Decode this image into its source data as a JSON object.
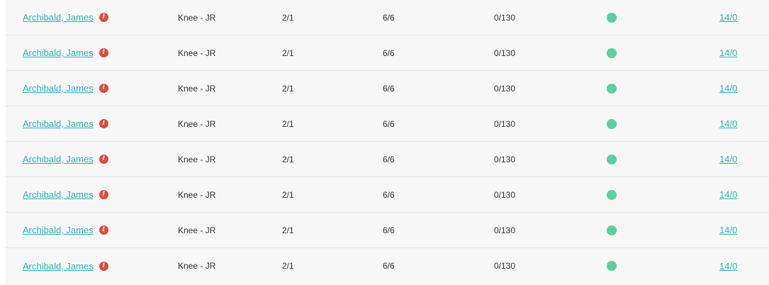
{
  "colors": {
    "link": "#2bb3c0",
    "info_icon": "#e0483e",
    "status_ok": "#5ccfa0",
    "row_bg": "#f7f7f7",
    "row_border": "#e6e6e6"
  },
  "rows": [
    {
      "name": "Archibald, James",
      "info_icon": "info-icon",
      "type": "Knee - JR",
      "col_a": "2/1",
      "col_b": "6/6",
      "col_c": "0/130",
      "status": "green",
      "count": "14/0"
    },
    {
      "name": "Archibald, James",
      "info_icon": "info-icon",
      "type": "Knee - JR",
      "col_a": "2/1",
      "col_b": "6/6",
      "col_c": "0/130",
      "status": "green",
      "count": "14/0"
    },
    {
      "name": "Archibald, James",
      "info_icon": "info-icon",
      "type": "Knee - JR",
      "col_a": "2/1",
      "col_b": "6/6",
      "col_c": "0/130",
      "status": "green",
      "count": "14/0"
    },
    {
      "name": "Archibald, James",
      "info_icon": "info-icon",
      "type": "Knee - JR",
      "col_a": "2/1",
      "col_b": "6/6",
      "col_c": "0/130",
      "status": "green",
      "count": "14/0"
    },
    {
      "name": "Archibald, James",
      "info_icon": "info-icon",
      "type": "Knee - JR",
      "col_a": "2/1",
      "col_b": "6/6",
      "col_c": "0/130",
      "status": "green",
      "count": "14/0"
    },
    {
      "name": "Archibald, James",
      "info_icon": "info-icon",
      "type": "Knee - JR",
      "col_a": "2/1",
      "col_b": "6/6",
      "col_c": "0/130",
      "status": "green",
      "count": "14/0"
    },
    {
      "name": "Archibald, James",
      "info_icon": "info-icon",
      "type": "Knee - JR",
      "col_a": "2/1",
      "col_b": "6/6",
      "col_c": "0/130",
      "status": "green",
      "count": "14/0"
    },
    {
      "name": "Archibald, James",
      "info_icon": "info-icon",
      "type": "Knee - JR",
      "col_a": "2/1",
      "col_b": "6/6",
      "col_c": "0/130",
      "status": "green",
      "count": "14/0"
    }
  ]
}
